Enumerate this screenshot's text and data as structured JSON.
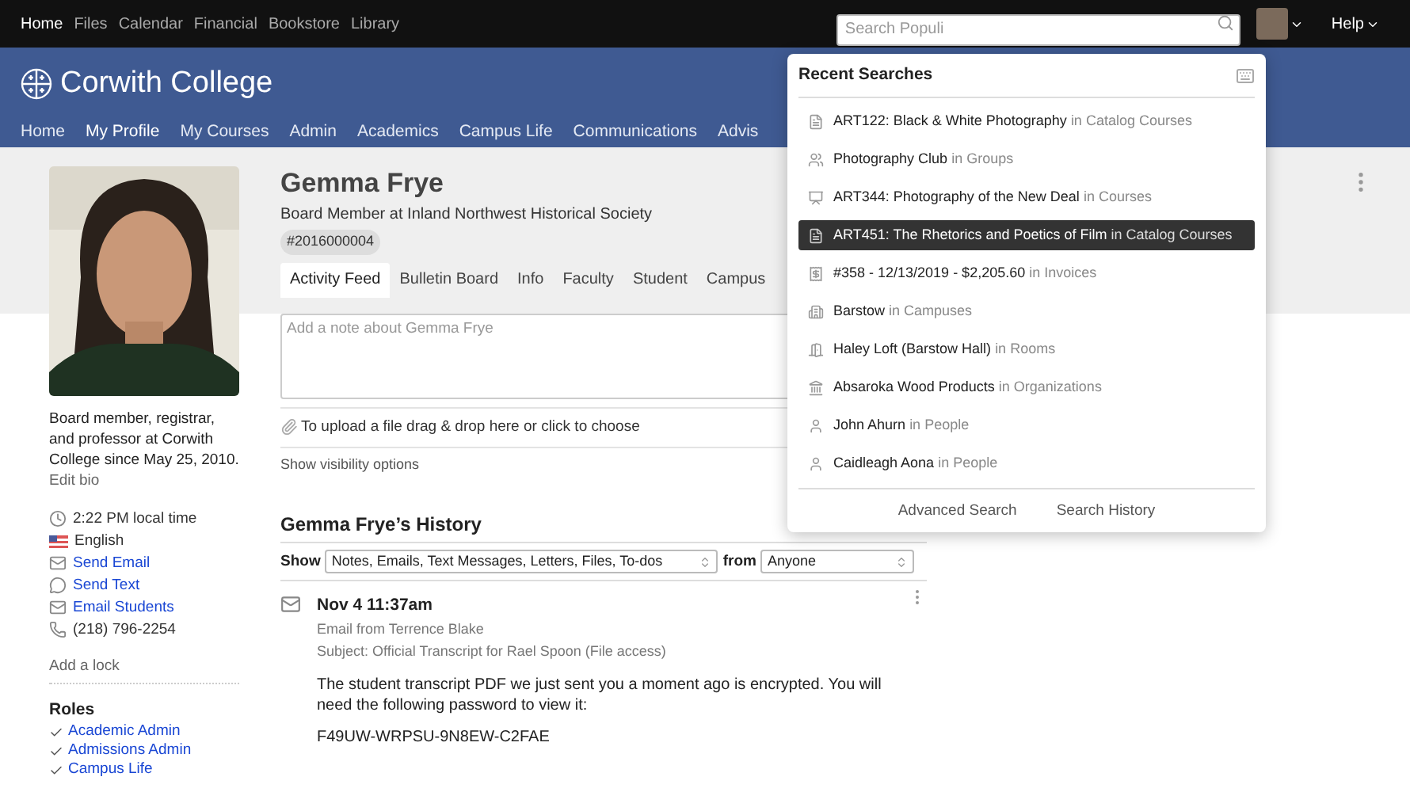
{
  "top_nav": [
    {
      "label": "Home",
      "selected": true
    },
    {
      "label": "Files",
      "selected": false
    },
    {
      "label": "Calendar",
      "selected": false
    },
    {
      "label": "Financial",
      "selected": false
    },
    {
      "label": "Bookstore",
      "selected": false
    },
    {
      "label": "Library",
      "selected": false
    }
  ],
  "search": {
    "placeholder": "Search Populi"
  },
  "help": {
    "label": "Help"
  },
  "college": {
    "name": "Corwith College"
  },
  "main_nav": [
    {
      "label": "Home",
      "selected": false
    },
    {
      "label": "My Profile",
      "selected": true
    },
    {
      "label": "My Courses",
      "selected": false
    },
    {
      "label": "Admin",
      "selected": false
    },
    {
      "label": "Academics",
      "selected": false
    },
    {
      "label": "Campus Life",
      "selected": false
    },
    {
      "label": "Communications",
      "selected": false
    },
    {
      "label": "Advis",
      "selected": false
    }
  ],
  "profile": {
    "name": "Gemma Frye",
    "subtitle": "Board Member at Inland Northwest Historical Society",
    "id_badge": "#2016000004",
    "bio": "Board member, registrar, and professor at Corwith College since May 25, 2010.",
    "edit_bio": "Edit bio",
    "contact": [
      {
        "kind": "time",
        "text": "2:22 PM local time"
      },
      {
        "kind": "language",
        "text": "English"
      },
      {
        "kind": "email",
        "text": "Send Email"
      },
      {
        "kind": "sms",
        "text": "Send Text"
      },
      {
        "kind": "email",
        "text": "Email Students"
      },
      {
        "kind": "phone",
        "text": "(218) 796-2254"
      }
    ],
    "add_lock": "Add a lock",
    "roles_title": "Roles",
    "roles": [
      "Academic Admin",
      "Admissions Admin",
      "Campus Life"
    ]
  },
  "tabs": [
    {
      "label": "Activity Feed",
      "selected": true
    },
    {
      "label": "Bulletin Board",
      "selected": false
    },
    {
      "label": "Info",
      "selected": false
    },
    {
      "label": "Faculty",
      "selected": false
    },
    {
      "label": "Student",
      "selected": false
    },
    {
      "label": "Campus",
      "selected": false
    }
  ],
  "note": {
    "placeholder": "Add a note about Gemma Frye"
  },
  "upload_hint": "To upload a file drag & drop here or click to choose",
  "visibility_link": "Show visibility options",
  "history": {
    "title": "Gemma Frye’s History",
    "show_label": "Show",
    "show_value": "Notes, Emails, Text Messages, Letters, Files, To-dos",
    "from_label": "from",
    "from_value": "Anyone",
    "entries": [
      {
        "kind": "email",
        "date": "Nov 4 11:37am",
        "from": "Email from Terrence Blake",
        "subject": "Subject: Official Transcript for Rael Spoon (File access)",
        "body": "The student transcript PDF we just sent you a moment ago is encrypted. You will need the following password to view it:",
        "code": "F49UW-WRPSU-9N8EW-C2FAE"
      }
    ]
  },
  "recent_searches": {
    "title": "Recent Searches",
    "items": [
      {
        "kind": "catalog",
        "name": "ART122: Black & White Photography",
        "context": "in Catalog Courses",
        "selected": false
      },
      {
        "kind": "group",
        "name": "Photography Club",
        "context": "in Groups",
        "selected": false
      },
      {
        "kind": "course",
        "name": "ART344: Photography of the New Deal",
        "context": "in Courses",
        "selected": false
      },
      {
        "kind": "catalog",
        "name": "ART451: The Rhetorics and Poetics of Film",
        "context": "in Catalog Courses",
        "selected": true
      },
      {
        "kind": "invoice",
        "name": "#358 - 12/13/2019 - $2,205.60",
        "context": "in Invoices",
        "selected": false
      },
      {
        "kind": "campus",
        "name": "Barstow",
        "context": "in Campuses",
        "selected": false
      },
      {
        "kind": "room",
        "name": "Haley Loft (Barstow Hall)",
        "context": "in Rooms",
        "selected": false
      },
      {
        "kind": "organization",
        "name": "Absaroka Wood Products",
        "context": "in Organizations",
        "selected": false
      },
      {
        "kind": "person",
        "name": "John Ahurn",
        "context": "in People",
        "selected": false
      },
      {
        "kind": "person",
        "name": "Caidleagh Aona",
        "context": "in People",
        "selected": false
      }
    ],
    "footer": [
      "Advanced Search",
      "Search History"
    ]
  }
}
